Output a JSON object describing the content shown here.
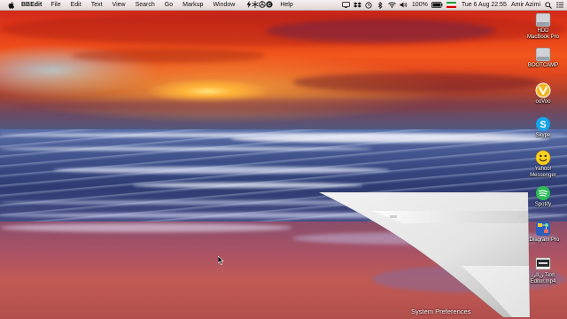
{
  "menubar": {
    "app_name": "BBEdit",
    "items": [
      "File",
      "Edit",
      "Text",
      "View",
      "Search",
      "Go",
      "Markup",
      "Window",
      "Help"
    ],
    "battery": "100%",
    "datetime": "Tue 6 Aug  22:55",
    "user": "Amir Azimi"
  },
  "desktop": {
    "icons": [
      {
        "label": "HDD\nMacBook Pro",
        "icon": "hard-drive-icon"
      },
      {
        "label": "BOOTCAMP",
        "icon": "hard-drive-icon"
      },
      {
        "label": "ooVoo",
        "icon": "oovoo-icon"
      },
      {
        "label": "Skype",
        "icon": "skype-icon"
      },
      {
        "label": "Yahoo!\nMessenger",
        "icon": "yahoo-messenger-icon"
      },
      {
        "label": "Spotify",
        "icon": "spotify-icon"
      },
      {
        "label": "xDiagram Pro",
        "icon": "xdiagram-icon"
      },
      {
        "label": "ﻦﻟ‏اﺮﺑ Text\nEditor.mp4",
        "icon": "video-file-icon"
      }
    ]
  },
  "window_curl": {
    "caption": "System Preferences"
  },
  "colors": {
    "sky_top": "#c8201a",
    "sun": "#ffe27a",
    "sea": "#3b4c86",
    "beach": "#b24f4c",
    "spotify": "#2ebd59",
    "skype": "#16a3e8"
  }
}
